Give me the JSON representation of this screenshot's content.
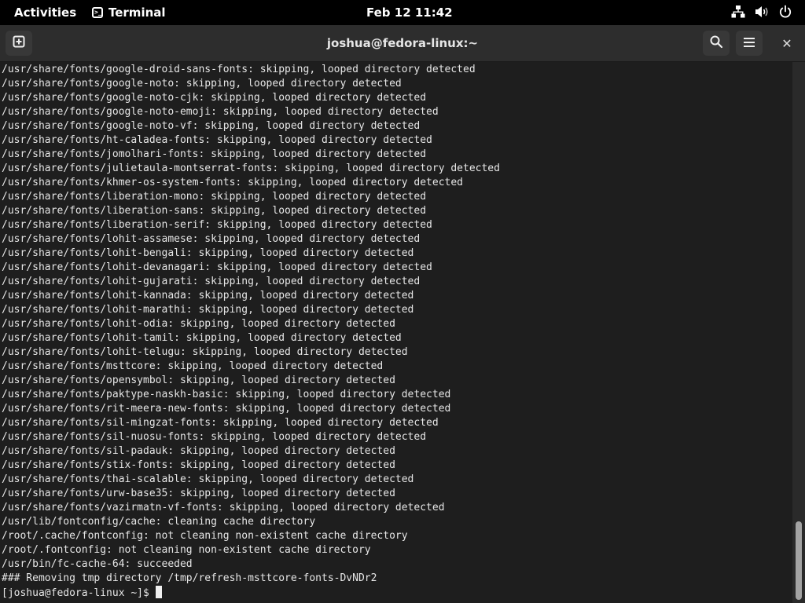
{
  "topbar": {
    "activities_label": "Activities",
    "app_name": "Terminal",
    "app_icon": "terminal-icon",
    "clock": "Feb 12  11:42",
    "tray_icons": [
      "network-icon",
      "volume-icon",
      "power-icon"
    ]
  },
  "window": {
    "title": "joshua@fedora-linux:~",
    "buttons": {
      "new_tab": "new-tab-icon",
      "search": "search-icon",
      "menu": "hamburger-menu-icon",
      "close": "close-icon",
      "close_glyph": "✕"
    }
  },
  "terminal": {
    "lines": [
      "/usr/share/fonts/google-droid-sans-fonts: skipping, looped directory detected",
      "/usr/share/fonts/google-noto: skipping, looped directory detected",
      "/usr/share/fonts/google-noto-cjk: skipping, looped directory detected",
      "/usr/share/fonts/google-noto-emoji: skipping, looped directory detected",
      "/usr/share/fonts/google-noto-vf: skipping, looped directory detected",
      "/usr/share/fonts/ht-caladea-fonts: skipping, looped directory detected",
      "/usr/share/fonts/jomolhari-fonts: skipping, looped directory detected",
      "/usr/share/fonts/julietaula-montserrat-fonts: skipping, looped directory detected",
      "/usr/share/fonts/khmer-os-system-fonts: skipping, looped directory detected",
      "/usr/share/fonts/liberation-mono: skipping, looped directory detected",
      "/usr/share/fonts/liberation-sans: skipping, looped directory detected",
      "/usr/share/fonts/liberation-serif: skipping, looped directory detected",
      "/usr/share/fonts/lohit-assamese: skipping, looped directory detected",
      "/usr/share/fonts/lohit-bengali: skipping, looped directory detected",
      "/usr/share/fonts/lohit-devanagari: skipping, looped directory detected",
      "/usr/share/fonts/lohit-gujarati: skipping, looped directory detected",
      "/usr/share/fonts/lohit-kannada: skipping, looped directory detected",
      "/usr/share/fonts/lohit-marathi: skipping, looped directory detected",
      "/usr/share/fonts/lohit-odia: skipping, looped directory detected",
      "/usr/share/fonts/lohit-tamil: skipping, looped directory detected",
      "/usr/share/fonts/lohit-telugu: skipping, looped directory detected",
      "/usr/share/fonts/msttcore: skipping, looped directory detected",
      "/usr/share/fonts/opensymbol: skipping, looped directory detected",
      "/usr/share/fonts/paktype-naskh-basic: skipping, looped directory detected",
      "/usr/share/fonts/rit-meera-new-fonts: skipping, looped directory detected",
      "/usr/share/fonts/sil-mingzat-fonts: skipping, looped directory detected",
      "/usr/share/fonts/sil-nuosu-fonts: skipping, looped directory detected",
      "/usr/share/fonts/sil-padauk: skipping, looped directory detected",
      "/usr/share/fonts/stix-fonts: skipping, looped directory detected",
      "/usr/share/fonts/thai-scalable: skipping, looped directory detected",
      "/usr/share/fonts/urw-base35: skipping, looped directory detected",
      "/usr/share/fonts/vazirmatn-vf-fonts: skipping, looped directory detected",
      "/usr/lib/fontconfig/cache: cleaning cache directory",
      "/root/.cache/fontconfig: not cleaning non-existent cache directory",
      "/root/.fontconfig: not cleaning non-existent cache directory",
      "/usr/bin/fc-cache-64: succeeded",
      "### Removing tmp directory /tmp/refresh-msttcore-fonts-DvNDr2"
    ],
    "prompt": "[joshua@fedora-linux ~]$ "
  }
}
